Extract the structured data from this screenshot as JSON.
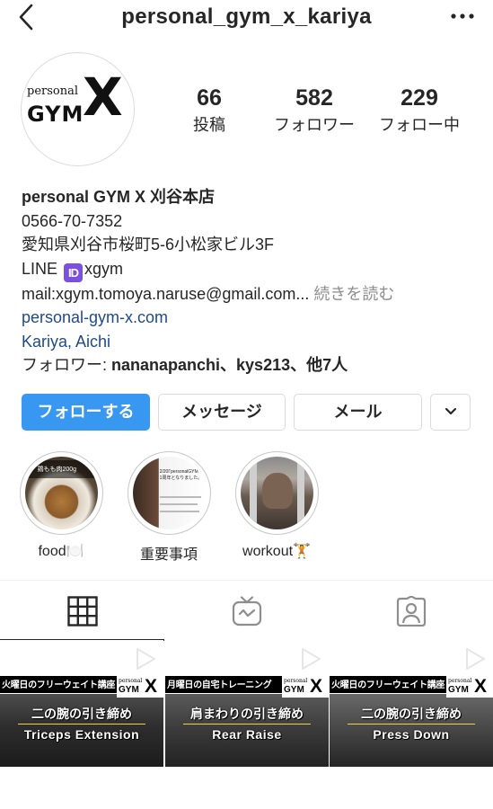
{
  "topbar": {
    "title": "personal_gym_x_kariya",
    "back_icon": "chevron-left-icon",
    "more_icon": "more-horizontal-icon"
  },
  "avatar": {
    "logo_small": "personal",
    "logo_gym": "GYM",
    "logo_x": "X"
  },
  "stats": [
    {
      "value": "66",
      "label": "投稿"
    },
    {
      "value": "582",
      "label": "フォロワー"
    },
    {
      "value": "229",
      "label": "フォロー中"
    }
  ],
  "bio": {
    "name": "personal GYM X 刈谷本店",
    "phone": "0566-70-7352",
    "address": "愛知県刈谷市桜町5-6小松家ビル3F",
    "line_prefix": "LINE ",
    "line_badge": "ID",
    "line_id": "xgym",
    "mail": "mail:xgym.tomoya.naruse@gmail.com...",
    "more": " 続きを読む",
    "website": "personal-gym-x.com",
    "location": "Kariya, Aichi",
    "followers_prefix": "フォロワー: ",
    "followers_names": "nananapanchi、kys213、他7人"
  },
  "buttons": {
    "follow": "フォローする",
    "message": "メッセージ",
    "email": "メール",
    "dropdown_icon": "chevron-down-icon"
  },
  "highlights": [
    {
      "label": "food🍽️",
      "cover_text": "鶏もも肉200g"
    },
    {
      "label": "重要事項",
      "cover_text": "2/20ΓpersonalGYM X\n1周年となりました。"
    },
    {
      "label": "workout🏋️",
      "cover_text": ""
    }
  ],
  "tabs": [
    {
      "name": "grid",
      "icon": "grid-icon",
      "active": true
    },
    {
      "name": "igtv",
      "icon": "igtv-icon",
      "active": false
    },
    {
      "name": "tagged",
      "icon": "tagged-person-icon",
      "active": false
    }
  ],
  "posts": [
    {
      "banner": "火曜日のフリーウェイト講座",
      "logo_small": "personal",
      "logo_gym": "GYM",
      "logo_x": "X",
      "jp": "二の腕の引き締め",
      "en": "Triceps Extension"
    },
    {
      "banner": "月曜日の自宅トレーニング",
      "logo_small": "personal",
      "logo_gym": "GYM",
      "logo_x": "X",
      "jp": "肩まわりの引き締め",
      "en": "Rear Raise"
    },
    {
      "banner": "火曜日のフリーウェイト講座",
      "logo_small": "personal",
      "logo_gym": "GYM",
      "logo_x": "X",
      "jp": "二の腕の引き締め",
      "en": "Press Down"
    }
  ],
  "colors": {
    "primary": "#3897f0",
    "link": "#1f4a8a",
    "muted": "#8e8e8e",
    "text": "#262626",
    "border": "#dbdbdb"
  }
}
